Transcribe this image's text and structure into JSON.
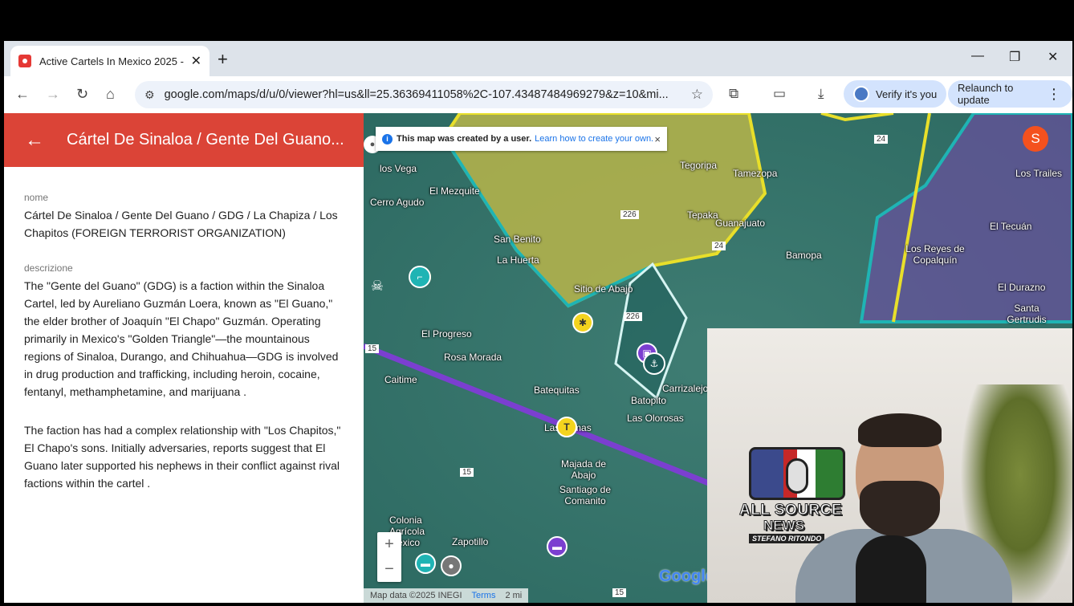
{
  "browser": {
    "tab_title": "Active Cartels In Mexico 2025 -",
    "tab_close": "✕",
    "new_tab": "+",
    "url": "google.com/maps/d/u/0/viewer?hl=us&ll=25.36369411058%2C-107.43487484969279&z=10&mi...",
    "verify_label": "Verify it's you",
    "relaunch_label": "Relaunch to update",
    "win_min": "—",
    "win_max": "❐",
    "win_close": "✕",
    "back": "←",
    "forward": "→",
    "reload": "↻",
    "home": "⌂",
    "tune": "⚙",
    "star": "☆",
    "ext": "⧉",
    "cast": "▭",
    "download": "⤓",
    "kebab": "⋮"
  },
  "panel": {
    "back_arrow": "←",
    "title": "Cártel De Sinaloa / Gente Del Guano...",
    "name_label": "nome",
    "name_value": "Cártel De Sinaloa / Gente Del Guano / GDG / La Chapiza / Los Chapitos (FOREIGN TERRORIST ORGANIZATION)",
    "desc_label": "descrizione",
    "desc_p1": "The \"Gente del Guano\" (GDG) is a faction within the Sinaloa Cartel, led by Aureliano Guzmán Loera, known as \"El Guano,\" the elder brother of Joaquín \"El Chapo\" Guzmán. Operating primarily in Mexico's \"Golden Triangle\"—the mountainous regions of Sinaloa, Durango, and Chihuahua—GDG is involved in drug production and trafficking, including heroin, cocaine, fentanyl, methamphetamine, and marijuana .",
    "desc_p2": "The faction has had a complex relationship with \"Los Chapitos,\" El Chapo's sons. Initially adversaries, reports suggest that El Guano later supported his nephews in their conflict against rival factions within the cartel ."
  },
  "map": {
    "notice_bold": "This map was created by a user.",
    "notice_link": "Learn how to create your own.",
    "notice_close": "×",
    "avatar_letter": "S",
    "zoom_in": "+",
    "zoom_out": "−",
    "attribution": "Map data ©2025 INEGI",
    "terms": "Terms",
    "scale": "2 mi",
    "google": "Google",
    "places": [
      {
        "name": "Tegoripa"
      },
      {
        "name": "Tamezopa"
      },
      {
        "name": "Tepaka"
      },
      {
        "name": "Guanajuato"
      },
      {
        "name": "Bamopa"
      },
      {
        "name": "El Mezquite"
      },
      {
        "name": "Cerro Agudo"
      },
      {
        "name": "San Benito"
      },
      {
        "name": "La Huerta"
      },
      {
        "name": "Sitio de Abajo"
      },
      {
        "name": "El Progreso"
      },
      {
        "name": "Rosa Morada"
      },
      {
        "name": "Caitime"
      },
      {
        "name": "Batequitas"
      },
      {
        "name": "Batopito"
      },
      {
        "name": "Carrizalejo"
      },
      {
        "name": "Las Olorosas"
      },
      {
        "name": "Majada de Abajo"
      },
      {
        "name": "Santiago de Comanito"
      },
      {
        "name": "Colonia Agrícola México"
      },
      {
        "name": "Zapotillo"
      },
      {
        "name": "Los Reyes de Copalquín"
      },
      {
        "name": "El Tecuán"
      },
      {
        "name": "El Durazno"
      },
      {
        "name": "Santa Gertrudis"
      },
      {
        "name": "Los Trailes"
      },
      {
        "name": "los Vega"
      },
      {
        "name": "Las Lomas"
      }
    ],
    "road_numbers": [
      "226",
      "24",
      "226",
      "15",
      "15",
      "15",
      "24"
    ]
  },
  "webcam": {
    "brand_line1": "ALL SOURCE",
    "brand_line2": "NEWS",
    "brand_line3": "STEFANO RITONDO"
  },
  "colors": {
    "panel_header": "#db4437",
    "map_teal": "#2a6b66",
    "yellow_zone": "#b5b13a",
    "purple_route": "#6a3fbf",
    "cyan_border": "#1fb4b4"
  }
}
